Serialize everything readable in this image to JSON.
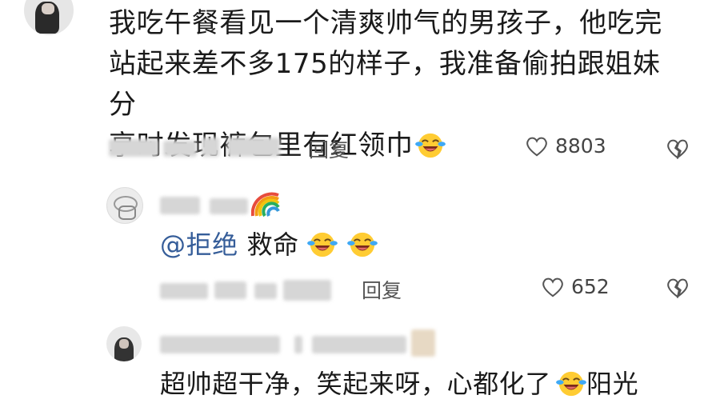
{
  "comments": [
    {
      "text_lines": [
        "我吃午餐看见一个清爽帅气的男孩子，他吃完",
        "站起来差不多175的样子，我准备偷拍跟姐妹分",
        "享时发现裤包里有红领巾"
      ],
      "emoji": "laughing-tears-icon",
      "reply_label": "回复",
      "like_count": "8803"
    }
  ],
  "replies": [
    {
      "mention": "@拒绝",
      "text": " 救命",
      "emojis": [
        "laughing-tears-icon",
        "laughing-tears-icon"
      ],
      "reply_label": "回复",
      "like_count": "652"
    },
    {
      "text_a": "超帅超干净，笑起来呀，心都化了",
      "emoji": "laughing-tears-icon",
      "text_b": "阳光"
    }
  ],
  "colors": {
    "mention": "#355d99",
    "text": "#1a1a1a",
    "meta": "#555555"
  }
}
